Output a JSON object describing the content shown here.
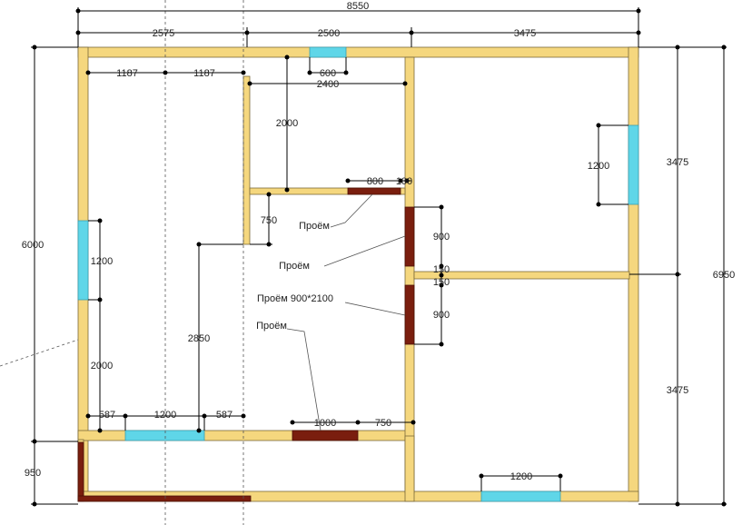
{
  "dimensions": {
    "total_width": "8550",
    "top_left": "2575",
    "top_mid": "2500",
    "top_right": "3475",
    "left_height": "6000",
    "left_bottom": "950",
    "right_height": "6950",
    "right_upper": "3475",
    "right_lower": "3475",
    "row_1187_a": "1187",
    "row_1187_b": "1187",
    "win_600": "600",
    "span_2400": "2400",
    "v_2000_top": "2000",
    "door_800": "800",
    "wall_100": "100",
    "v_750": "750",
    "v_900_a": "900",
    "v_150_a": "150",
    "v_150_b": "150",
    "v_900_b": "900",
    "win_left_1200": "1200",
    "v_2000_left": "2000",
    "v_2850": "2850",
    "bot_587_a": "587",
    "bot_1200": "1200",
    "bot_587_b": "587",
    "door_1000": "1000",
    "bot_750": "750",
    "win_right_1200": "1200",
    "win_bottom_right_1200": "1200"
  },
  "labels": {
    "opening_1": "Проём",
    "opening_2": "Проём",
    "opening_3": "Проём 900*2100",
    "opening_4": "Проём"
  },
  "colors": {
    "wall": "#f5d77e",
    "window": "#5fd6e8",
    "door": "#7a1e0e"
  }
}
